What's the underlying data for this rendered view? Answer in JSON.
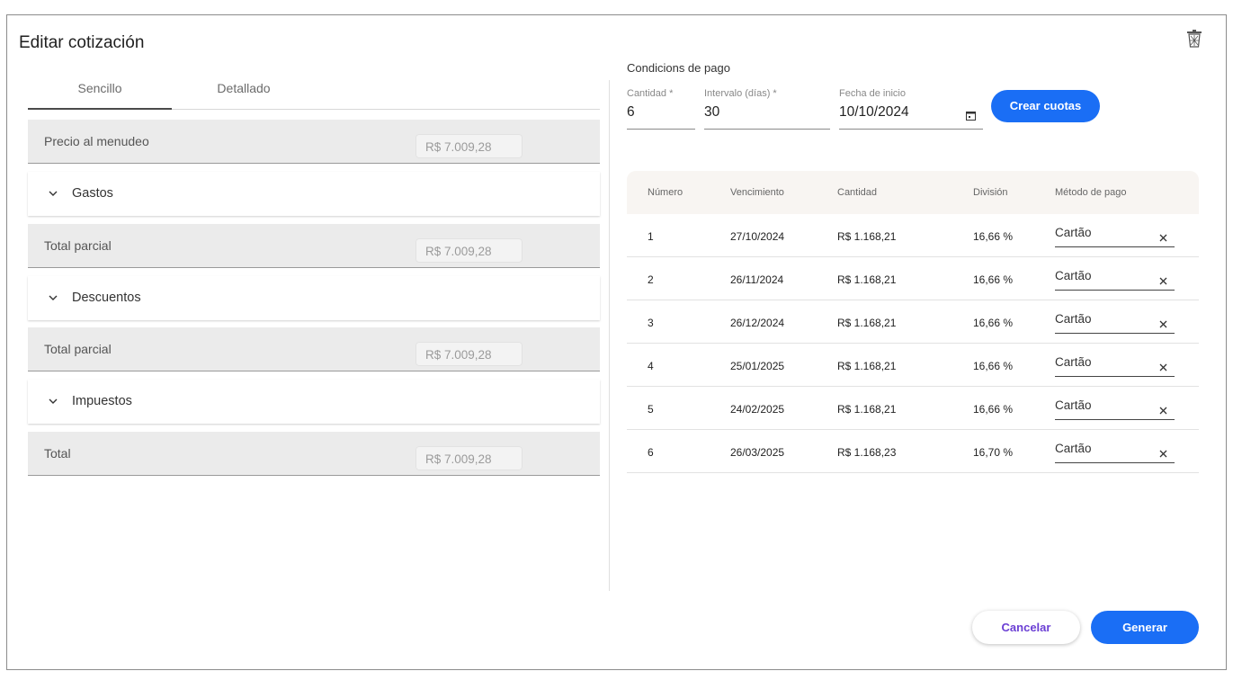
{
  "dialog": {
    "title": "Editar cotización"
  },
  "tabs": [
    {
      "label": "Sencillo"
    },
    {
      "label": "Detallado"
    }
  ],
  "summary": {
    "retail": {
      "label": "Precio al menudeo",
      "value": "R$ 7.009,28"
    },
    "expenses": {
      "label": "Gastos"
    },
    "subtotal1": {
      "label": "Total parcial",
      "value": "R$ 7.009,28"
    },
    "discounts": {
      "label": "Descuentos"
    },
    "subtotal2": {
      "label": "Total parcial",
      "value": "R$ 7.009,28"
    },
    "taxes": {
      "label": "Impuestos"
    },
    "total": {
      "label": "Total",
      "value": "R$ 7.009,28"
    }
  },
  "payment": {
    "title": "Condicions de pago",
    "quantity": {
      "label": "Cantidad *",
      "value": "6"
    },
    "interval": {
      "label": "Intervalo (días) *",
      "value": "30"
    },
    "start_date": {
      "label": "Fecha de inicio",
      "value": "10/10/2024"
    },
    "create_button": "Crear cuotas"
  },
  "table": {
    "headers": [
      "Número",
      "Vencimiento",
      "Cantidad",
      "División",
      "Método de pago"
    ],
    "rows": [
      {
        "number": "1",
        "due": "27/10/2024",
        "amount": "R$ 1.168,21",
        "division": "16,66 %",
        "method": "Cartão"
      },
      {
        "number": "2",
        "due": "26/11/2024",
        "amount": "R$ 1.168,21",
        "division": "16,66 %",
        "method": "Cartão"
      },
      {
        "number": "3",
        "due": "26/12/2024",
        "amount": "R$ 1.168,21",
        "division": "16,66 %",
        "method": "Cartão"
      },
      {
        "number": "4",
        "due": "25/01/2025",
        "amount": "R$ 1.168,21",
        "division": "16,66 %",
        "method": "Cartão"
      },
      {
        "number": "5",
        "due": "24/02/2025",
        "amount": "R$ 1.168,21",
        "division": "16,66 %",
        "method": "Cartão"
      },
      {
        "number": "6",
        "due": "26/03/2025",
        "amount": "R$ 1.168,23",
        "division": "16,70 %",
        "method": "Cartão"
      }
    ]
  },
  "footer": {
    "cancel": "Cancelar",
    "generate": "Generar"
  },
  "colors": {
    "primary": "#1a6ef5",
    "cancel_text": "#6b3fd4"
  },
  "icons": [
    "trash-icon",
    "chevron-down-icon",
    "calendar-icon",
    "close-icon"
  ]
}
